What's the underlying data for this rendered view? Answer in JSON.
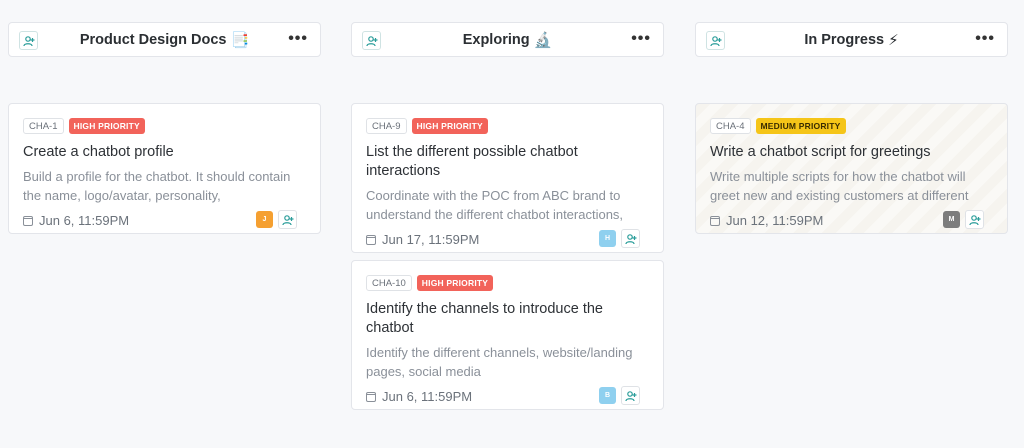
{
  "columns": [
    {
      "title": "Product Design Docs",
      "emoji": "📑"
    },
    {
      "title": "Exploring",
      "emoji": "🔬"
    },
    {
      "title": "In Progress",
      "emoji": "⚡"
    }
  ],
  "more_label": "•••",
  "cards": [
    {
      "id": "CHA-1",
      "priority": "HIGH PRIORITY",
      "title": "Create a chatbot profile",
      "desc": "Build a profile for the chatbot. It should contain the name, logo/avatar, personality,",
      "date": "Jun 6, 11:59PM",
      "avatar": "J",
      "avatar_color": "#f5a031"
    },
    {
      "id": "CHA-9",
      "priority": "HIGH PRIORITY",
      "title": "List the different possible chatbot interactions",
      "desc": "Coordinate with the POC from ABC brand to understand the different chatbot interactions,",
      "date": "Jun 17, 11:59PM",
      "avatar": "H",
      "avatar_color": "#8fd0ef"
    },
    {
      "id": "CHA-10",
      "priority": "HIGH PRIORITY",
      "title": "Identify the channels to introduce the chatbot",
      "desc": "Identify the different channels, website/landing pages, social media",
      "date": "Jun 6, 11:59PM",
      "avatar": "B",
      "avatar_color": "#8fd0ef"
    },
    {
      "id": "CHA-4",
      "priority": "MEDIUM PRIORITY",
      "title": "Write a chatbot script for greetings",
      "desc": "Write multiple scripts for how the chatbot will greet new and existing customers at different",
      "date": "Jun 12, 11:59PM",
      "avatar": "M",
      "avatar_color": "#7d7d7d"
    }
  ],
  "colors": {
    "high": "#f2635a",
    "medium": "#f5c518",
    "accent": "#2a9d9a"
  }
}
